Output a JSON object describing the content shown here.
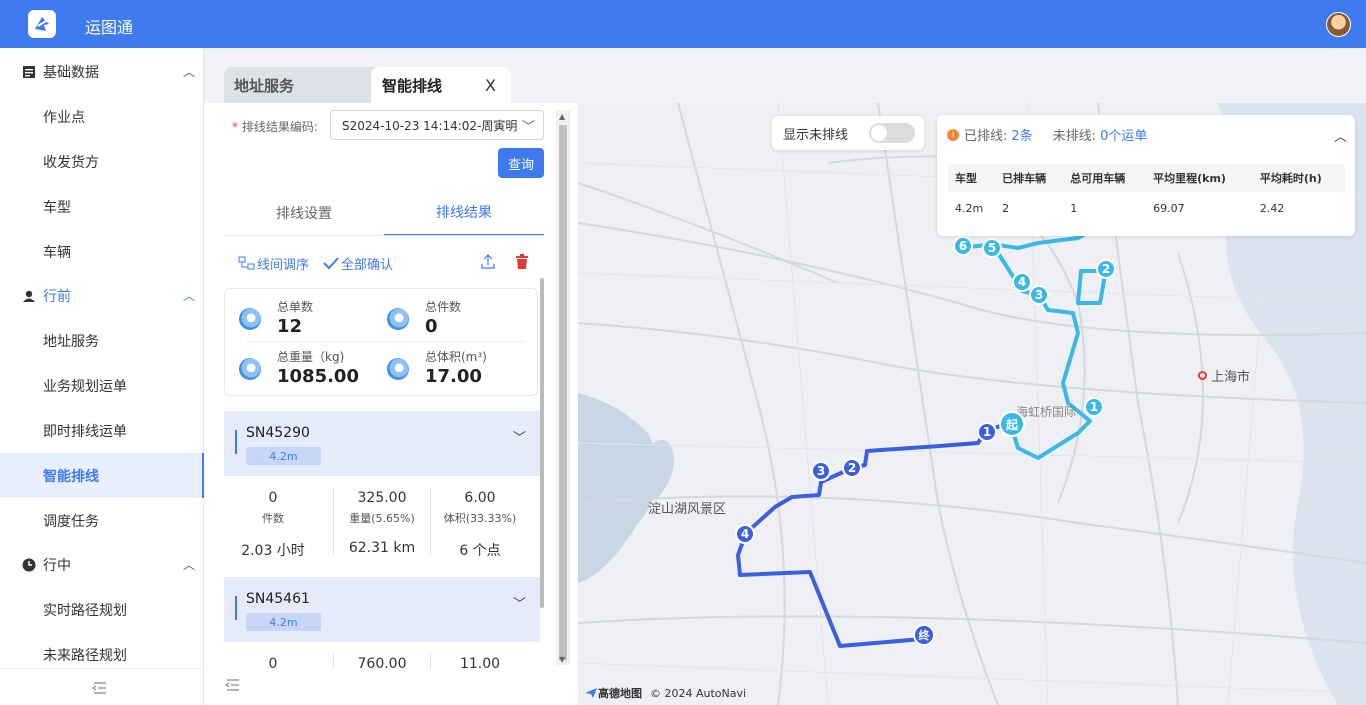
{
  "app": {
    "title": "运图通"
  },
  "sidebar": {
    "groups": [
      {
        "label": "基础数据",
        "items": [
          "作业点",
          "收发货方",
          "车型",
          "车辆"
        ]
      },
      {
        "label": "行前",
        "items": [
          "地址服务",
          "业务规划运单",
          "即时排线运单",
          "智能排线",
          "调度任务"
        ]
      },
      {
        "label": "行中",
        "items": [
          "实时路径规划",
          "未来路径规划"
        ]
      }
    ],
    "active": "智能排线"
  },
  "tabs": [
    {
      "label": "地址服务"
    },
    {
      "label": "智能排线",
      "close": "X"
    }
  ],
  "form": {
    "label": "排线结果编码:",
    "required_mark": "*",
    "value": "S2024-10-23 14:14:02-周寅明",
    "query_button": "查询"
  },
  "subtabs": [
    "排线设置",
    "排线结果"
  ],
  "actions": {
    "reorder": "线间调序",
    "confirm_all": "全部确认"
  },
  "stats": [
    {
      "label": "总单数",
      "value": "12"
    },
    {
      "label": "总件数",
      "value": "0"
    },
    {
      "label": "总重量（kg)",
      "value": "1085.00"
    },
    {
      "label": "总体积(m³)",
      "value": "17.00"
    }
  ],
  "routes": [
    {
      "id": "SN45290",
      "type": "4.2m",
      "count": "0",
      "count_label": "件数",
      "weight": "325.00",
      "weight_label": "重量(5.65%)",
      "volume": "6.00",
      "volume_label": "体积(33.33%)",
      "time": "2.03 小时",
      "distance": "62.31 km",
      "points": "6 个点"
    },
    {
      "id": "SN45461",
      "type": "4.2m",
      "count": "0",
      "weight": "760.00",
      "volume": "11.00"
    }
  ],
  "map": {
    "toggle_label": "显示未排线",
    "summary": {
      "scheduled_label": "已排线:",
      "scheduled_value": "2条",
      "unscheduled_label": "未排线:",
      "unscheduled_value": "0个运单"
    },
    "table": {
      "headers": [
        "车型",
        "已排车辆",
        "总可用车辆",
        "平均里程(km)",
        "平均耗时(h)"
      ],
      "rows": [
        [
          "4.2m",
          "2",
          "1",
          "69.07",
          "2.42"
        ]
      ]
    },
    "labels": {
      "city": "上海市",
      "lake": "淀山湖风景区",
      "airport": "海虹桥国际"
    },
    "markers_dark": [
      "起",
      "1",
      "2",
      "3",
      "4",
      "终"
    ],
    "markers_light": [
      "1",
      "2",
      "3",
      "4",
      "5",
      "6"
    ],
    "attribution": {
      "brand": "高德地图",
      "copyright": "© 2024 AutoNavi"
    },
    "colors": {
      "route_dark": "#3b5fe0",
      "route_light": "#3cb8e6"
    }
  }
}
